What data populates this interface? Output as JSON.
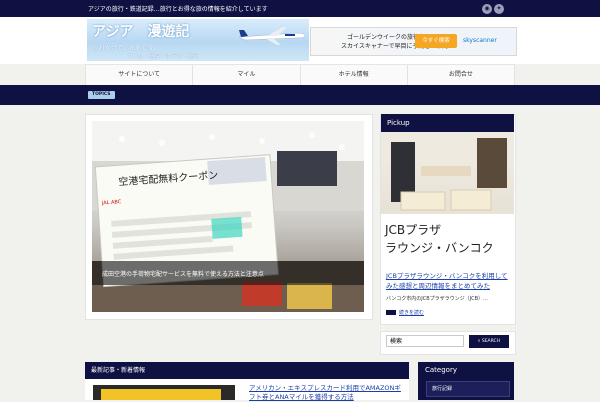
{
  "topbar": {
    "tagline": "アジアの旅行・鉄道記録…旅行とお得な旅の情報を紹介しています",
    "icons": [
      "rss-icon",
      "twitter-icon"
    ]
  },
  "header": {
    "logo_title": "アジア　漫遊記",
    "logo_sub1": "忘れかけていたあの旅",
    "logo_sub2": "マイル・航空・ホテル・旅行",
    "ad": {
      "line1": "ゴールデンウイークの旅行を",
      "line2": "スカイスキャナーで早目に予約して節約",
      "button": "今すぐ検索",
      "brand": "skyscanner"
    }
  },
  "nav": {
    "items": [
      "サイトについて",
      "マイル",
      "ホテル情報",
      "お問合せ"
    ]
  },
  "topics_label": "TOPICS",
  "featured": {
    "caption": "成田空港の手荷物宅配サービスを無料で使える方法と注意点",
    "photo_text": {
      "banner": "空港宅配無料クーポン",
      "airline": "JAL ABC"
    }
  },
  "pickup": {
    "heading": "Pickup",
    "image_text_line1": "JCBプラザ",
    "image_text_line2": "ラウンジ・バンコク",
    "title": "JCBプラザラウンジ・バンコクを利用してみた感想と周辺情報をまとめてみた",
    "desc": "バンコク市内のJCBプラザラウンジ（JCB）...",
    "more": "続きを読む"
  },
  "search": {
    "value": "検索",
    "button": "SEARCH"
  },
  "recent": {
    "heading": "最新記事・新着情報",
    "article_title": "アメリカン・エキスプレスカード利用でAMAZONギフト券とANAマイルを獲得する方法"
  },
  "category": {
    "heading": "Category",
    "item": "旅行記録"
  },
  "colors": {
    "navy": "#0f1142",
    "link": "#1b3ea8",
    "accent_light": "#aacfe8"
  }
}
